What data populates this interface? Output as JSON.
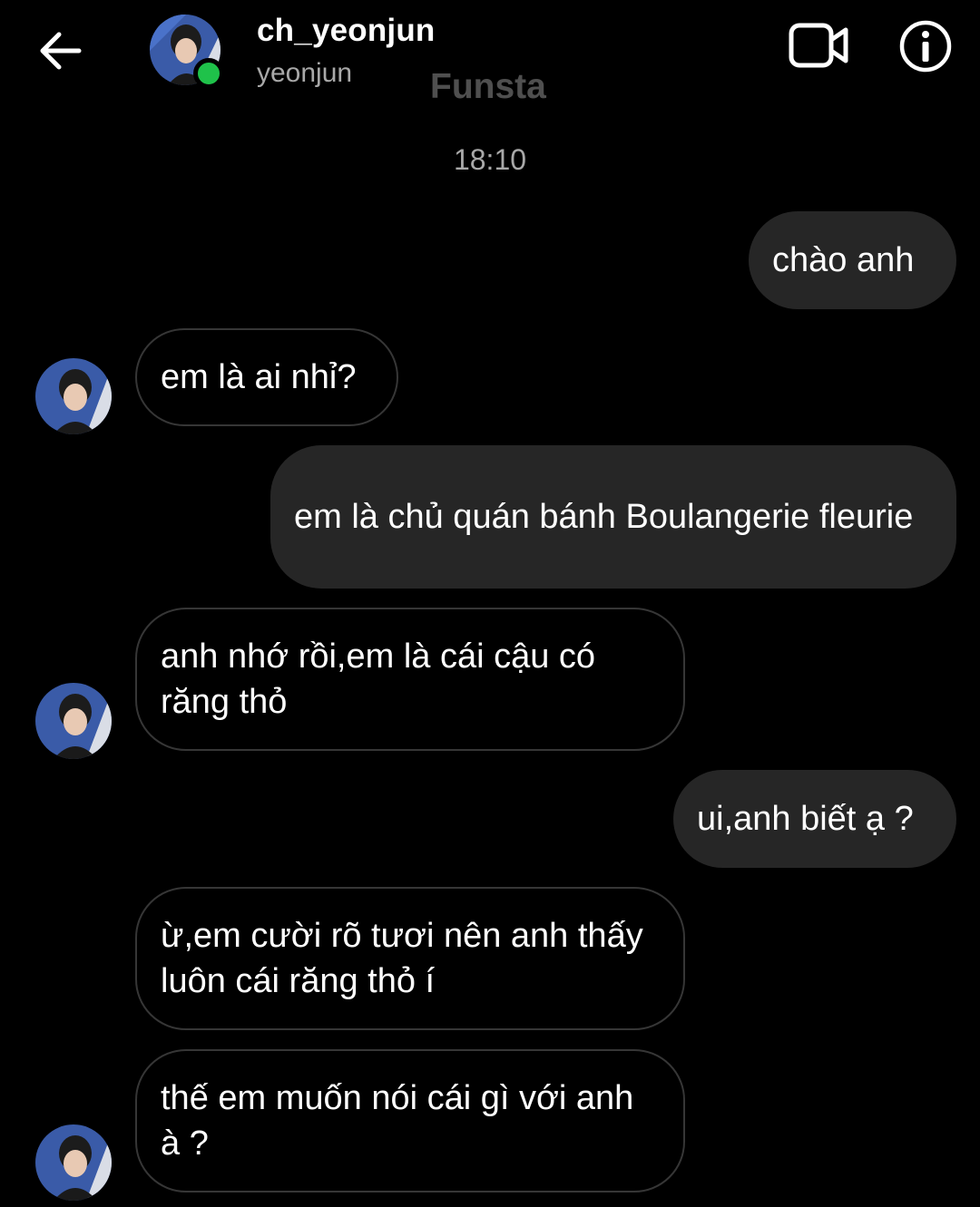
{
  "header": {
    "username": "ch_yeonjun",
    "subtitle": "yeonjun",
    "label": "Funsta",
    "back_icon": "arrow-left-icon",
    "video_icon": "video-camera-icon",
    "info_icon": "info-icon",
    "online_color": "#1fc24a"
  },
  "conversation": {
    "timestamp": "18:10",
    "messages": [
      {
        "from": "me",
        "text": "chào anh"
      },
      {
        "from": "them",
        "text": "em là ai nhỉ?"
      },
      {
        "from": "me",
        "text": "em là chủ quán bánh Boulangerie fleurie"
      },
      {
        "from": "them",
        "text": "anh nhớ rồi,em là cái cậu có răng thỏ"
      },
      {
        "from": "me",
        "text": "ui,anh biết ạ ?"
      },
      {
        "from": "them",
        "text": "ừ,em cười rõ tươi nên anh thấy luôn cái răng thỏ í"
      },
      {
        "from": "them",
        "text": "thế em muốn nói cái gì với anh à ?"
      }
    ]
  },
  "colors": {
    "background": "#000000",
    "sent_bubble": "#262626",
    "received_border": "#363636",
    "secondary_text": "#a8a8a8"
  }
}
